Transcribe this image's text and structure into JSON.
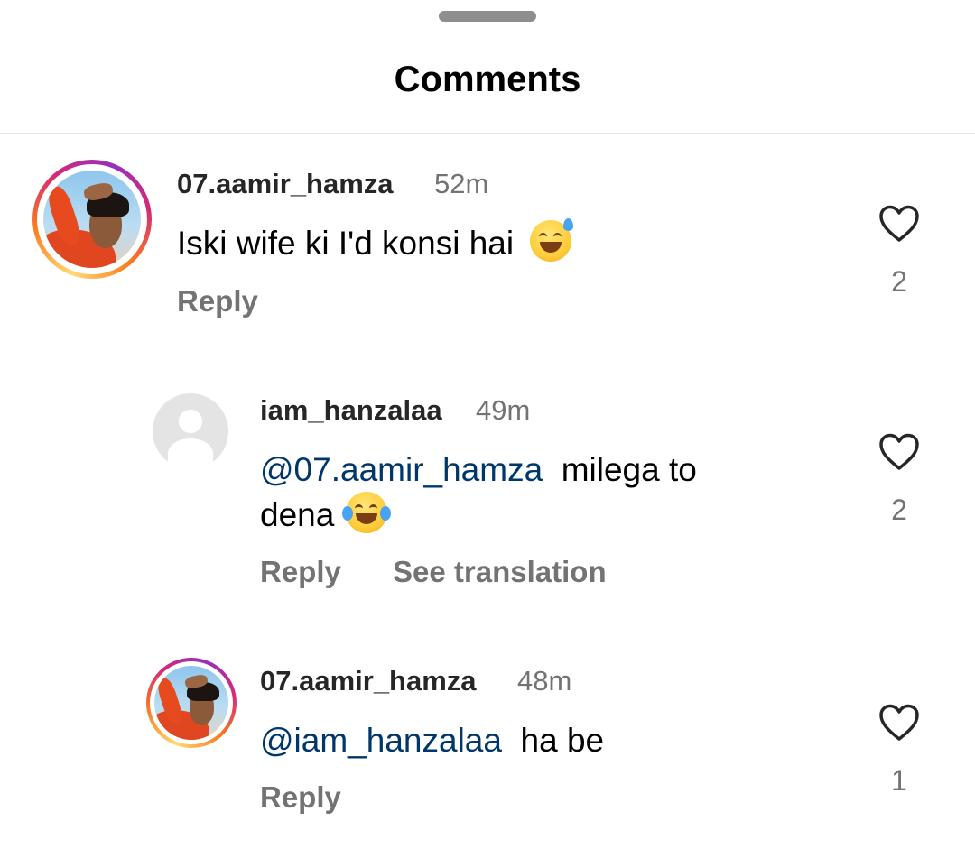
{
  "sheet": {
    "title": "Comments"
  },
  "comments": [
    {
      "username": "07.aamir_hamza",
      "time": "52m",
      "mention": "",
      "text": "Iski wife ki I'd konsi hai",
      "text_line2": "",
      "emoji": "sweat-smile-emoji",
      "reply_label": "Reply",
      "translate_label": "",
      "likes": "2"
    },
    {
      "username": "iam_hanzalaa",
      "time": "49m",
      "mention": "@07.aamir_hamza",
      "text": "milega to",
      "text_line2": "dena",
      "emoji": "tears-of-joy-emoji",
      "reply_label": "Reply",
      "translate_label": "See translation",
      "likes": "2"
    },
    {
      "username": "07.aamir_hamza",
      "time": "48m",
      "mention": "@iam_hanzalaa",
      "text": "ha be",
      "text_line2": "",
      "emoji": "",
      "reply_label": "Reply",
      "translate_label": "",
      "likes": "1"
    }
  ],
  "colors": {
    "text": "#000000",
    "username": "#262626",
    "secondary": "#737373",
    "mention": "#00376b",
    "divider": "#e8e8e8"
  }
}
